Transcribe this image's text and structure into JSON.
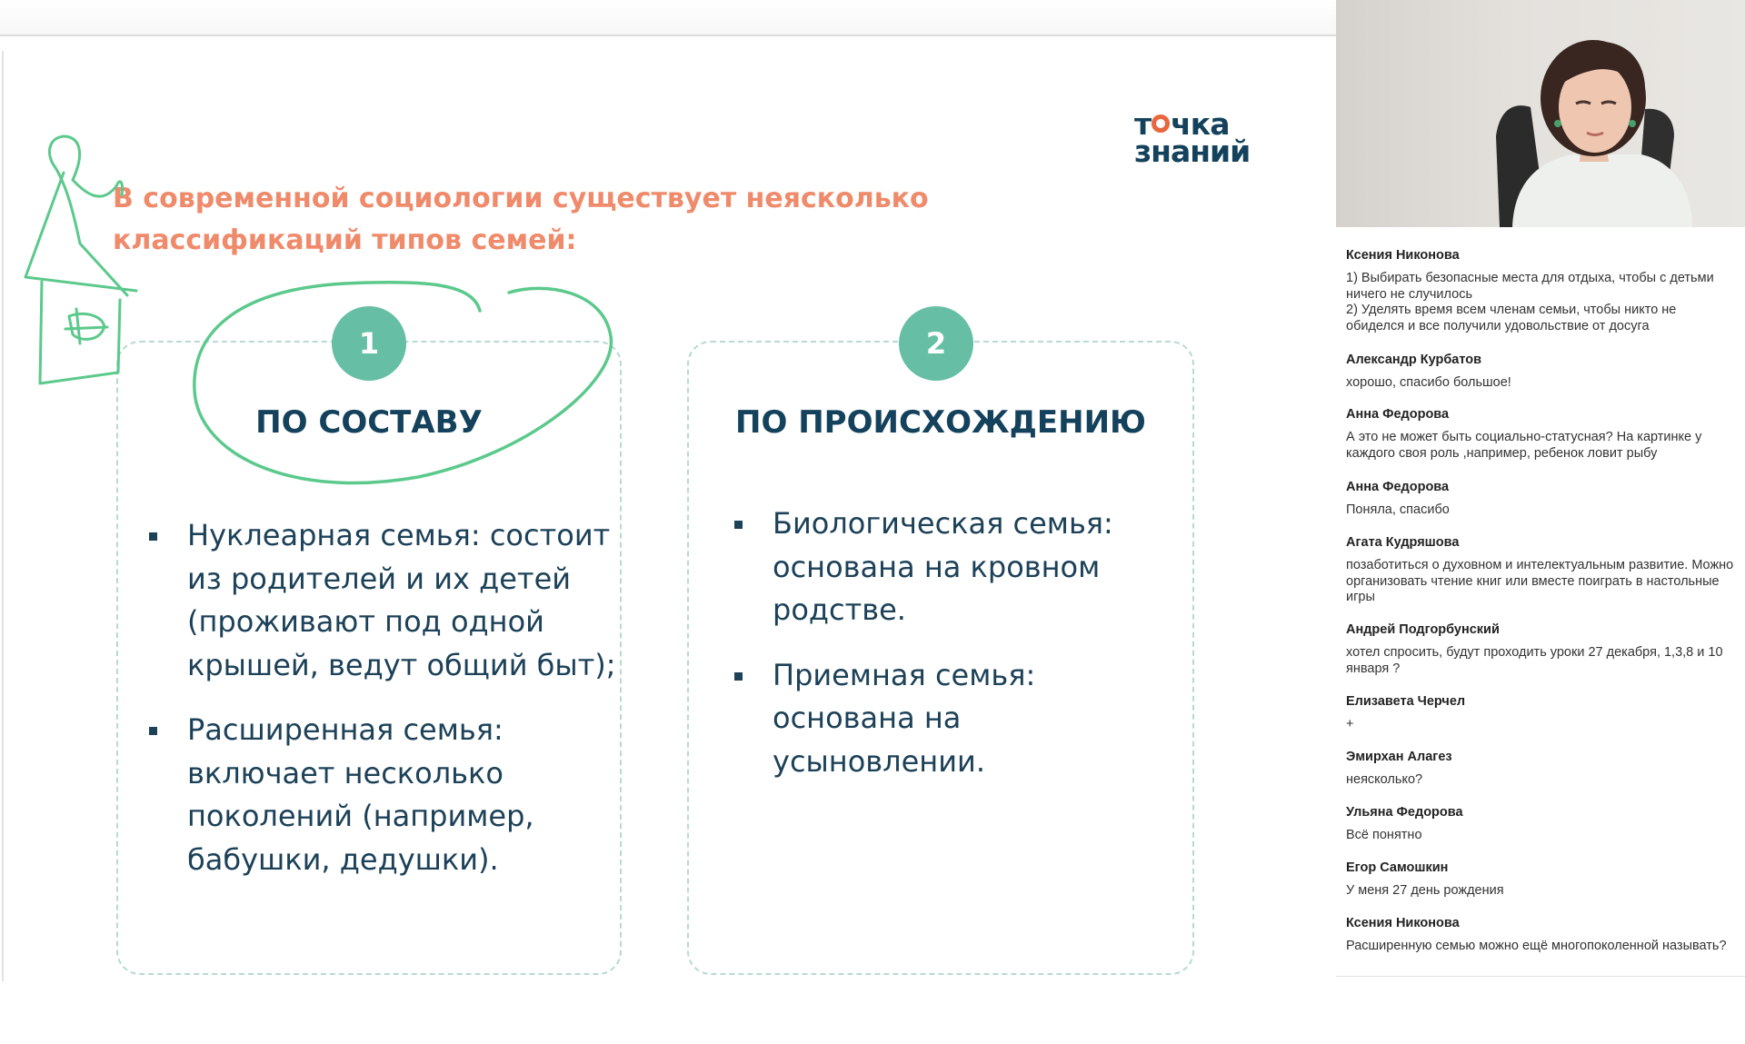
{
  "slide": {
    "logo": {
      "line1_before": "т",
      "line1_after": "чка",
      "line2": "знаний"
    },
    "heading": "В современной социологии существует неясколько классификаций типов семей:",
    "cards": [
      {
        "number": "1",
        "title": "ПО СОСТАВУ",
        "items": [
          "Нуклеарная семья: состоит из родителей и их детей (проживают под одной крышей, ведут общий быт);",
          "Расширенная семья: включает несколько поколений (например, бабушки, дедушки)."
        ]
      },
      {
        "number": "2",
        "title": "ПО ПРОИСХОЖДЕНИЮ",
        "items": [
          "Биологическая семья: основана на кровном родстве.",
          "Приемная семья: основана на усыновлении."
        ]
      }
    ],
    "colors": {
      "accent": "#ef8a6b",
      "navy": "#14425c",
      "teal": "#66bfa4",
      "annotation": "#5cc98c"
    }
  },
  "chat": {
    "messages": [
      {
        "author": "Ксения Никонова",
        "text": "1) Выбирать безопасные места для отдыха, чтобы с детьми ничего не случилось\n2) Уделять время всем членам семьи, чтобы никто не обиделся и все получили удовольствие от досуга"
      },
      {
        "author": "Александр Курбатов",
        "text": "хорошо, спасибо большое!"
      },
      {
        "author": "Анна Федорова",
        "text": "А это не может быть социально-статусная? На картинке у каждого своя роль ,например, ребенок ловит рыбу"
      },
      {
        "author": "Анна Федорова",
        "text": "Поняла, спасибо"
      },
      {
        "author": "Агата Кудряшова",
        "text": "позаботиться о духовном и интелектуальным развитие. Можно организовать чтение книг  или вместе поиграть в настольные игры"
      },
      {
        "author": "Андрей Подгорбунский",
        "text": "хотел спросить, будут проходить уроки 27 декабря, 1,3,8 и 10 января ?"
      },
      {
        "author": "Елизавета Черчел",
        "text": "+"
      },
      {
        "author": "Эмирхан Алагез",
        "text": "неясколько?"
      },
      {
        "author": "Ульяна Федорова",
        "text": "Всё понятно"
      },
      {
        "author": "Егор Самошкин",
        "text": "У меня 27 день рождения"
      },
      {
        "author": "Ксения Никонова",
        "text": "Расширенную семью можно ещё многопоколенной называть?"
      }
    ]
  },
  "icons": [
    "person-video-feed",
    "house-doodle-icon",
    "circle-annotation"
  ]
}
